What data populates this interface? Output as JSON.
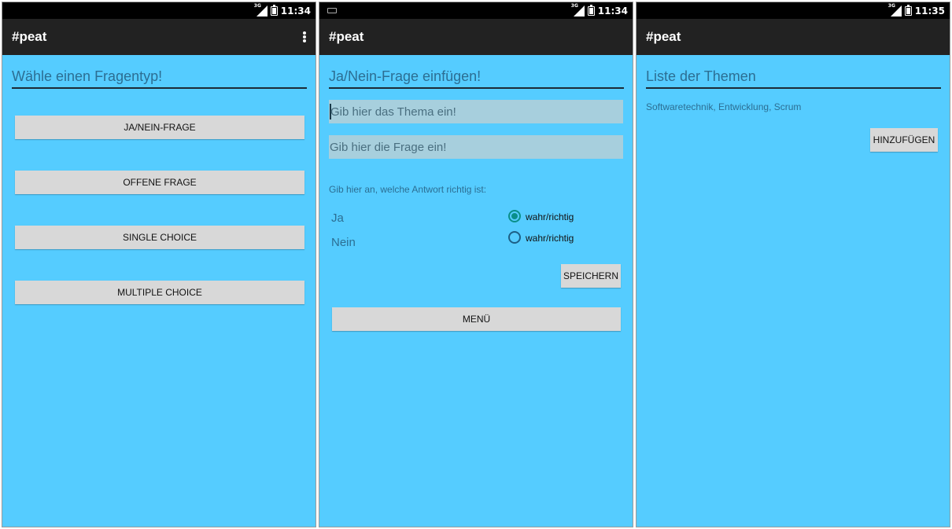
{
  "screens": [
    {
      "status": {
        "time": "11:34",
        "network": "3G"
      },
      "app_title": "#peat",
      "heading": "Wähle einen Fragentyp!",
      "buttons": [
        "JA/NEIN-FRAGE",
        "OFFENE FRAGE",
        "SINGLE CHOICE",
        "MULTIPLE CHOICE"
      ]
    },
    {
      "status": {
        "time": "11:34",
        "network": "3G"
      },
      "app_title": "#peat",
      "heading": "Ja/Nein-Frage einfügen!",
      "topic_placeholder": "Gib hier das Thema ein!",
      "question_placeholder": "Gib hier die Frage ein!",
      "instruction": "Gib hier an, welche Antwort richtig ist:",
      "options": [
        {
          "label": "Ja",
          "radio_label": "wahr/richtig",
          "checked": true
        },
        {
          "label": "Nein",
          "radio_label": "wahr/richtig",
          "checked": false
        }
      ],
      "save_button": "SPEICHERN",
      "menu_button": "MENÜ"
    },
    {
      "status": {
        "time": "11:35",
        "network": "3G"
      },
      "app_title": "#peat",
      "heading": "Liste der Themen",
      "topics": "Softwaretechnik, Entwicklung, Scrum",
      "add_button": "HINZUFÜGEN"
    }
  ],
  "colors": {
    "background": "#55ccff",
    "appbar": "#222222",
    "statusbar": "#000000",
    "button": "#d8d8d8",
    "field": "#a7cfdd",
    "heading_text": "#2c6e93",
    "radio_checked": "#0a8f8a"
  }
}
